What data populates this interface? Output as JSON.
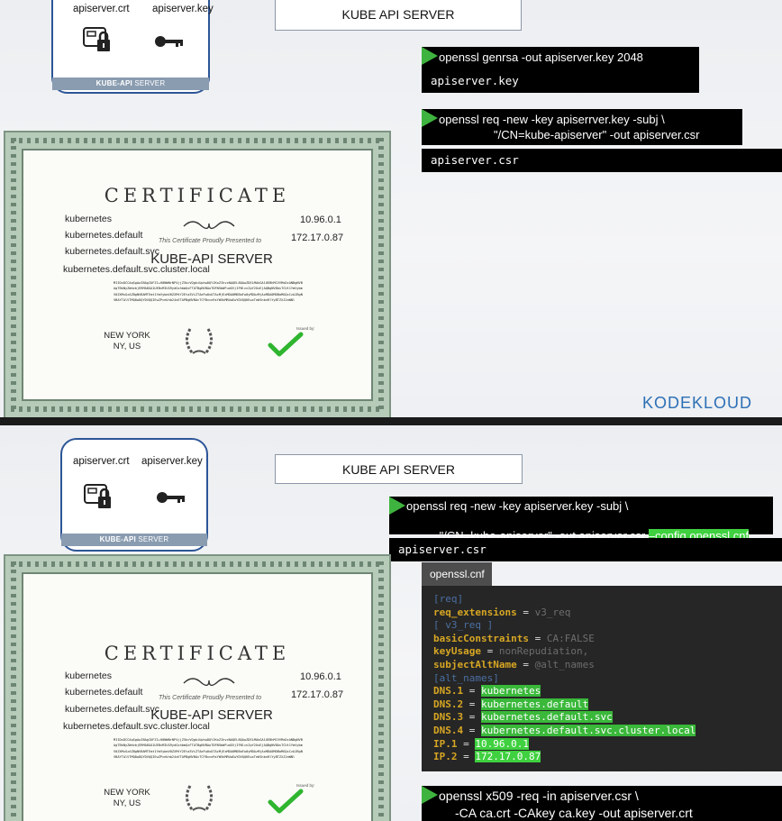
{
  "slides": [
    {
      "server": {
        "crt_label": "apiserver.crt",
        "key_label": "apiserver.key",
        "band_bold": "KUBE-API",
        "band_rest": " SERVER"
      },
      "title": "KUBE API SERVER",
      "cmd1": "openssl genrsa -out apiserver.key 2048",
      "out1": "apiserver.key",
      "cmd2_line1": "openssl req -new -key apiserrver.key -subj \\",
      "cmd2_line2": "\"/CN=kube-apiserver\" -out apiserver.csr",
      "out2": "apiserver.csr",
      "logo": "KODEKLOUD"
    },
    {
      "server": {
        "crt_label": "apiserver.crt",
        "key_label": "apiserver.key",
        "band_bold": "KUBE-API",
        "band_rest": " SERVER"
      },
      "title": "KUBE API SERVER",
      "cmd1_line1": "openssl req -new -key apiserver.key -subj \\",
      "cmd1_line2": "\"/CN=kube-apiserver\" -out apiserver.csr ",
      "cmd1_config": "–config openssl.cnf",
      "out1": "apiserver.csr",
      "cnf_title": "openssl.cnf",
      "cmd3_line1": "openssl x509 -req -in apiserver.csr \\",
      "cmd3_line2": "-CA ca.crt -CAkey ca.key -out apiserver.crt"
    }
  ],
  "certificate": {
    "title": "CERTIFICATE",
    "dns": [
      "kubernetes",
      "kubernetes.default",
      "kubernetes.default.svc",
      "kubernetes.default.svc.cluster.local"
    ],
    "ips": [
      "10.96.0.1",
      "172.17.0.87"
    ],
    "presented": "This Certificate Proudly Presented to",
    "name": "KUBE-API SERVER",
    "blob": "MIIDxDCCAqSgAwIBAgIUFZ1+H0NWNrNP4jjZ5kcVQgkiUphwDQYJKoZIhvcNAQELBQAwZDELMAkGA1UEBhMCVVMxDzANBgNVBAgTBkNyZWdvbjERMA8GA1UEBxMIUG9ydGxhbmQxFTATBgNVBAoTDFN5bWFudGVjIFNlcnZpY2UxEjAQBgNVBAsTCUt1YmVybmV0ZXMxGzAZBgNVBAMTEmt1YmVybmV0ZXMtY2Eta3ViZTAeFw0xOTAzMjExMDA0MDBaFw0yMDAzMjAxMDA0MDBaMGQxCzAJBgNVBAYTAlVTMQ8wDQYDVQQIEwZPcmVnb24xETAPBgNVBAcTCFBvcnRsYW5kMRUwEwYDVQQKEwxTeW1hbnRlYyBTZXJ2aWNl",
    "location": [
      "NEW YORK",
      "NY, US"
    ],
    "issued": "Issued by:"
  },
  "cnf_lines": [
    [
      {
        "t": "[req]",
        "c": "sec"
      }
    ],
    [
      {
        "t": "req_extensions",
        "c": "k"
      },
      {
        "t": " = ",
        "c": "op"
      },
      {
        "t": "v3_req",
        "c": "v"
      }
    ],
    [
      {
        "t": "[ v3_req ]",
        "c": "sec"
      }
    ],
    [
      {
        "t": "basicConstraints",
        "c": "k"
      },
      {
        "t": " = ",
        "c": "op"
      },
      {
        "t": "CA:FALSE",
        "c": "v"
      }
    ],
    [
      {
        "t": "keyUsage",
        "c": "k"
      },
      {
        "t": " = ",
        "c": "op"
      },
      {
        "t": "nonRepudiation,",
        "c": "v"
      }
    ],
    [
      {
        "t": "subjectAltName",
        "c": "k"
      },
      {
        "t": " = ",
        "c": "op"
      },
      {
        "t": "@alt_names",
        "c": "v"
      }
    ],
    [
      {
        "t": "[alt_names]",
        "c": "sec"
      }
    ],
    [
      {
        "t": "DNS.1",
        "c": "k"
      },
      {
        "t": " = ",
        "c": "op"
      },
      {
        "t": "kubernetes",
        "c": "hl"
      }
    ],
    [
      {
        "t": "DNS.2",
        "c": "k"
      },
      {
        "t": " = ",
        "c": "op"
      },
      {
        "t": "kubernetes.default",
        "c": "hl"
      }
    ],
    [
      {
        "t": "DNS.3",
        "c": "k"
      },
      {
        "t": " = ",
        "c": "op"
      },
      {
        "t": "kubernetes.default.svc",
        "c": "hl"
      }
    ],
    [
      {
        "t": "DNS.4",
        "c": "k"
      },
      {
        "t": " = ",
        "c": "op"
      },
      {
        "t": "kubernetes.default.svc.cluster.local",
        "c": "hl"
      }
    ],
    [
      {
        "t": "IP.1",
        "c": "k"
      },
      {
        "t": " = ",
        "c": "op"
      },
      {
        "t": "10.96.0.1",
        "c": "hlbright"
      }
    ],
    [
      {
        "t": "IP.2",
        "c": "k"
      },
      {
        "t": " = ",
        "c": "op"
      },
      {
        "t": "172.17.0.87",
        "c": "hlbright"
      }
    ]
  ],
  "colors": {
    "accent_green": "#3fb33f",
    "server_border": "#2c5597",
    "logo_blue": "#2c6fb5"
  }
}
